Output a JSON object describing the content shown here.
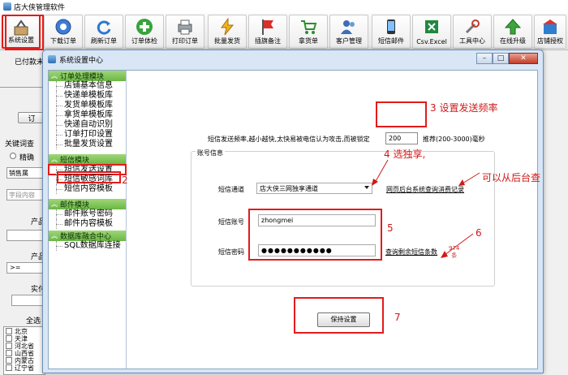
{
  "app_title": "店大侠管理软件",
  "toolbar": {
    "buttons": [
      {
        "label": "系统设置"
      },
      {
        "label": "下载订单"
      },
      {
        "label": "刷新订单"
      },
      {
        "label": "订单体检"
      },
      {
        "label": "打印订单"
      },
      {
        "label": "批量发货"
      },
      {
        "label": "插旗备注"
      },
      {
        "label": "拿货单"
      },
      {
        "label": "客户管理"
      },
      {
        "label": "短信邮件"
      },
      {
        "label": "Csv.Excel"
      },
      {
        "label": "工具中心"
      },
      {
        "label": "在线升级"
      },
      {
        "label": "店铺授权"
      }
    ]
  },
  "background_window": {
    "paid_prefix": "已付款未",
    "button_1": "订",
    "keyword_label": "关键词查",
    "radio_label": "精确",
    "field_1": "销售属",
    "field_2_placeholder": "字段内容",
    "product_label_1": "产品",
    "product_label_2": "产品",
    "op_value": ">=",
    "real_label": "实付",
    "all_label": "全选",
    "provinces": [
      "北京",
      "天津",
      "河北省",
      "山西省",
      "内蒙古",
      "辽宁省"
    ]
  },
  "dialog": {
    "title": "系统设置中心",
    "controls": {
      "minimize": "–",
      "maximize": "□",
      "close": "✕"
    },
    "sidebar": [
      {
        "group": "订单处理模块",
        "items": [
          "店铺基本信息",
          "快递单模板库",
          "发货单模板库",
          "拿货单模板库",
          "快递自动识别",
          "订单打印设置",
          "批量发货设置"
        ]
      },
      {
        "group": "短信模块",
        "items": [
          "短信发送设置",
          "短信敏感词库",
          "短信内容模板"
        ]
      },
      {
        "group": "邮件模块",
        "items": [
          "邮件账号密码",
          "邮件内容模板"
        ]
      },
      {
        "group": "数据库融合中心",
        "items": [
          "SQL数据库连接"
        ]
      }
    ],
    "panel": {
      "freq_label": "短信发送频率,越小越快,太快易被电信认为攻击,而被锁定",
      "freq_value": "200",
      "freq_hint": "推荐(200-3000)毫秒",
      "group_title": "账号信息",
      "channel_label": "短信通道",
      "channel_value": "店大侠三网独享通道",
      "channel_link": "网页后台系统查询消费记录",
      "account_label": "短信账号",
      "account_value": "zhongmei",
      "password_label": "短信密码",
      "password_value": "●●●●●●●●●●●",
      "balance_link": "查询剩余短信条数",
      "balance_count": "974",
      "balance_unit": "条",
      "save_label": "保持设置"
    }
  },
  "annotations": {
    "n2": "2",
    "n3": "3 设置发送频率",
    "n4": "4 选独享,",
    "can_check": "可以从后台查",
    "n5": "5",
    "n6": "6",
    "n7": "7"
  }
}
